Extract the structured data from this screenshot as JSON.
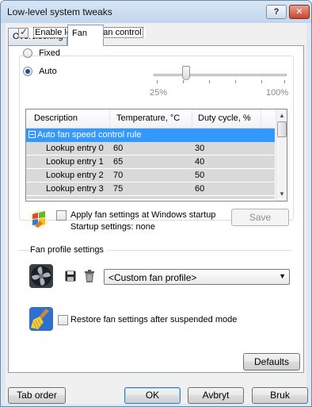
{
  "window": {
    "title": "Low-level system tweaks",
    "help_label": "?",
    "close_label": "✕"
  },
  "tabs": [
    {
      "label": "Overclocking",
      "active": false
    },
    {
      "label": "Fan",
      "active": true
    }
  ],
  "fan_control": {
    "enable_label": "Enable low-level fan control",
    "enable_checked": true,
    "mode_fixed_label": "Fixed",
    "mode_auto_label": "Auto",
    "selected_mode": "Auto",
    "slider": {
      "min_label": "25%",
      "max_label": "100%",
      "value_percent": 36
    }
  },
  "fan_table": {
    "columns": [
      "Description",
      "Temperature, °C",
      "Duty cycle, %"
    ],
    "group_label": "Auto fan speed control rule",
    "rows": [
      {
        "description": "Lookup entry 0",
        "temperature": "60",
        "duty": "30"
      },
      {
        "description": "Lookup entry 1",
        "temperature": "65",
        "duty": "40"
      },
      {
        "description": "Lookup entry 2",
        "temperature": "70",
        "duty": "50"
      },
      {
        "description": "Lookup entry 3",
        "temperature": "75",
        "duty": "60"
      }
    ]
  },
  "startup": {
    "apply_label": "Apply fan settings at Windows startup",
    "apply_checked": false,
    "settings_text": "Startup settings:  none",
    "save_label": "Save"
  },
  "profile": {
    "group_label": "Fan profile settings",
    "selected": "<Custom fan profile>"
  },
  "restore": {
    "label": "Restore fan settings after suspended mode",
    "checked": false
  },
  "buttons": {
    "defaults": "Defaults",
    "tab_order": "Tab order",
    "ok": "OK",
    "cancel": "Avbryt",
    "apply": "Bruk"
  },
  "icons": {
    "help": "help-icon",
    "close": "close-icon",
    "app": "windows-flag-icon",
    "fan": "fan-icon",
    "save": "floppy-disk-icon",
    "delete": "trash-icon",
    "restore": "broom-icon"
  }
}
